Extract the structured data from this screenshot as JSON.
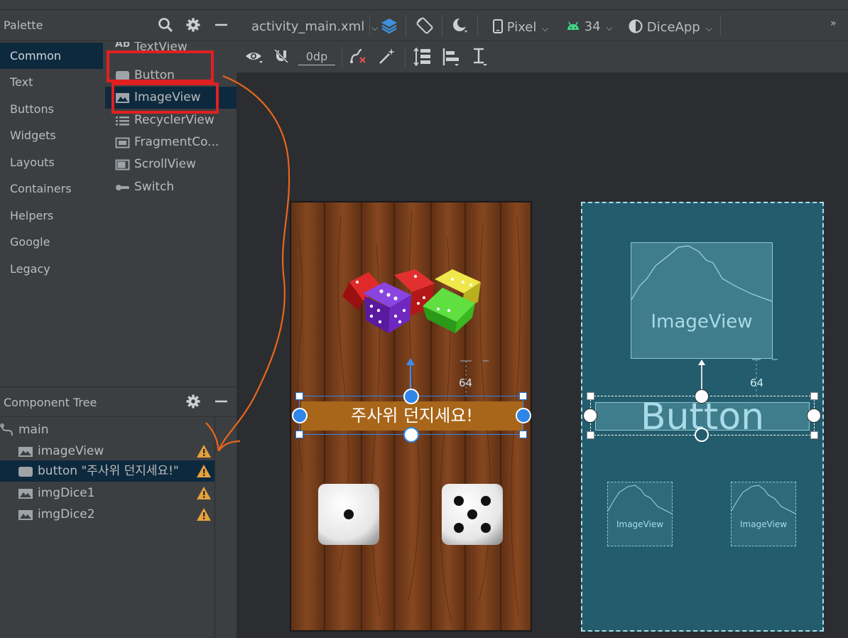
{
  "palette": {
    "title": "Palette",
    "categories": [
      "Common",
      "Text",
      "Buttons",
      "Widgets",
      "Layouts",
      "Containers",
      "Helpers",
      "Google",
      "Legacy"
    ],
    "items": [
      {
        "label": "TextView",
        "icon": "textview-icon"
      },
      {
        "label": "Button",
        "icon": "button-icon"
      },
      {
        "label": "ImageView",
        "icon": "image-icon"
      },
      {
        "label": "RecyclerView",
        "icon": "list-icon"
      },
      {
        "label": "FragmentCo...",
        "icon": "fragment-icon"
      },
      {
        "label": "ScrollView",
        "icon": "scrollview-icon"
      },
      {
        "label": "Switch",
        "icon": "switch-icon"
      }
    ]
  },
  "tree": {
    "title": "Component Tree",
    "root": "main",
    "rows": [
      {
        "label": "imageView",
        "icon": "image-icon"
      },
      {
        "label": "button \"주사위 던지세요!\"",
        "icon": "button-icon"
      },
      {
        "label": "imgDice1",
        "icon": "image-icon"
      },
      {
        "label": "imgDice2",
        "icon": "image-icon"
      }
    ]
  },
  "toolbar": {
    "file": "activity_main.xml",
    "device": "Pixel",
    "api": "34",
    "theme": "DiceApp",
    "margin": "0dp"
  },
  "design": {
    "button_text": "주사위 던지세요!",
    "margin_label": "64",
    "dice1_value": 1,
    "dice2_value": 5
  },
  "blueprint": {
    "imageview_label": "ImageView",
    "button_label": "Button",
    "margin_label": "64",
    "small_label_1": "ImageView",
    "small_label_2": "ImageView"
  },
  "colors": {
    "accent_blue": "#2f86e8",
    "highlight_red": "#e02020",
    "annotation_orange": "#e8661c",
    "button_brown": "#a8661a",
    "blueprint_bg": "#235c6c"
  }
}
